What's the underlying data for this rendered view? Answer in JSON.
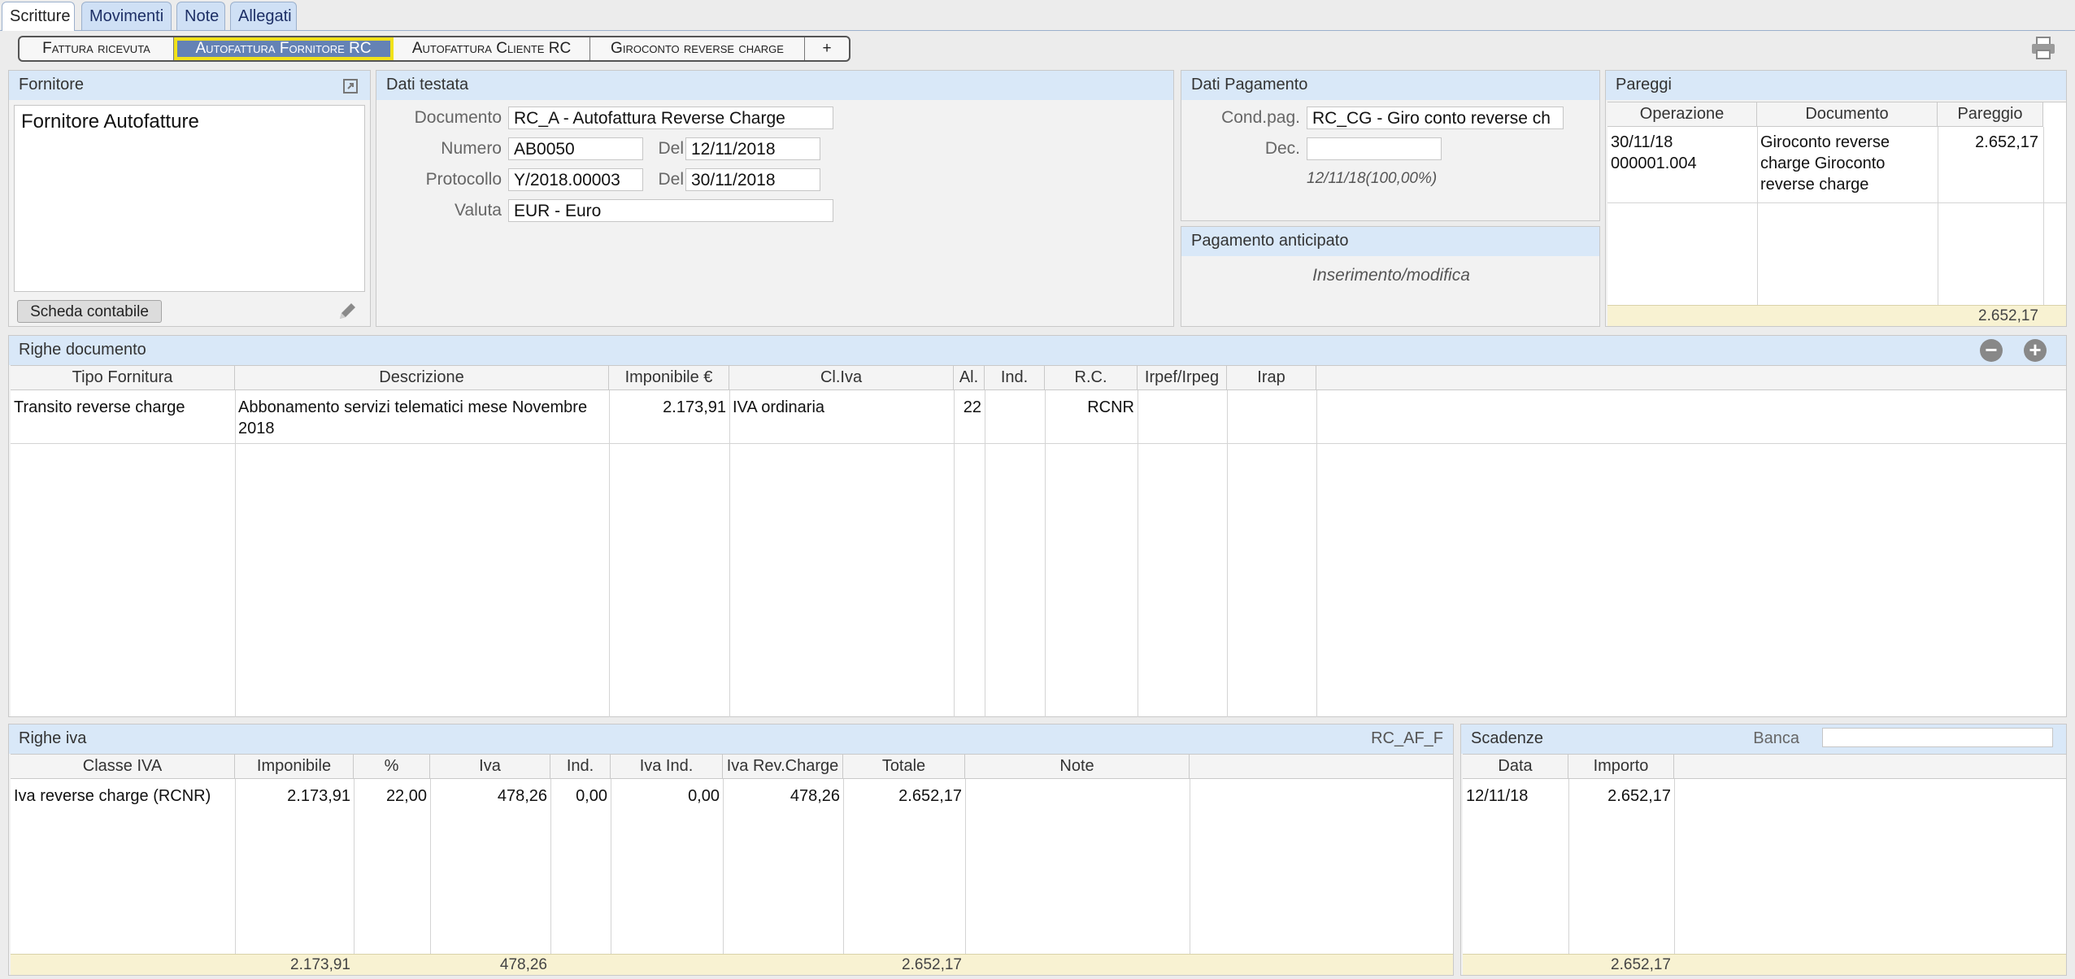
{
  "top_tabs": [
    "Scritture",
    "Movimenti",
    "Note",
    "Allegati"
  ],
  "segments": [
    "Fattura ricevuta",
    "Autofattura Fornitore RC",
    "Autofattura Cliente RC",
    "Giroconto reverse charge",
    "+"
  ],
  "fornitore": {
    "title": "Fornitore",
    "name": "Fornitore Autofatture",
    "button": "Scheda contabile"
  },
  "dati_testata": {
    "title": "Dati testata",
    "documento_label": "Documento",
    "documento": "RC_A - Autofattura Reverse Charge",
    "numero_label": "Numero",
    "numero": "AB0050",
    "del_label": "Del",
    "numero_del": "12/11/2018",
    "protocollo_label": "Protocollo",
    "protocollo": "Y/2018.00003",
    "protocollo_del": "30/11/2018",
    "valuta_label": "Valuta",
    "valuta": "EUR - Euro"
  },
  "dati_pagamento": {
    "title": "Dati Pagamento",
    "cond_label": "Cond.pag.",
    "cond": "RC_CG - Giro conto reverse ch",
    "dec_label": "Dec.",
    "dec": "",
    "info": "12/11/18(100,00%)"
  },
  "pagamento_anticipato": {
    "title": "Pagamento anticipato",
    "text": "Inserimento/modifica"
  },
  "pareggi": {
    "title": "Pareggi",
    "columns": [
      "Operazione",
      "Documento",
      "Pareggio"
    ],
    "rows": [
      {
        "operazione": "30/11/18\n000001.004",
        "documento": "Giroconto reverse\ncharge Giroconto\nreverse charge",
        "pareggio": "2.652,17"
      }
    ],
    "total": "2.652,17"
  },
  "righe_documento": {
    "title": "Righe documento",
    "columns": [
      "Tipo Fornitura",
      "Descrizione",
      "Imponibile €",
      "Cl.Iva",
      "Al.",
      "Ind.",
      "R.C.",
      "Irpef/Irpeg",
      "Irap"
    ],
    "rows": [
      {
        "tipo": "Transito reverse charge",
        "descrizione": "Abbonamento servizi telematici mese Novembre\n2018",
        "imponibile": "2.173,91",
        "cliva": "IVA ordinaria",
        "al": "22",
        "ind": "",
        "rc": "RCNR",
        "irpef": "",
        "irap": ""
      }
    ]
  },
  "righe_iva": {
    "title": "Righe iva",
    "code": "RC_AF_F",
    "columns": [
      "Classe IVA",
      "Imponibile",
      "%",
      "Iva",
      "Ind.",
      "Iva Ind.",
      "Iva Rev.Charge",
      "Totale",
      "Note"
    ],
    "rows": [
      {
        "classe": "Iva reverse charge (RCNR)",
        "imponibile": "2.173,91",
        "perc": "22,00",
        "iva": "478,26",
        "ind": "0,00",
        "iva_ind": "0,00",
        "iva_rev": "478,26",
        "totale": "2.652,17",
        "note": ""
      }
    ],
    "totals": {
      "imponibile": "2.173,91",
      "iva": "478,26",
      "totale": "2.652,17"
    }
  },
  "scadenze": {
    "title": "Scadenze",
    "banca_label": "Banca",
    "banca": "",
    "columns": [
      "Data",
      "Importo"
    ],
    "rows": [
      {
        "data": "12/11/18",
        "importo": "2.652,17"
      }
    ],
    "total": "2.652,17"
  },
  "icons": {
    "print": "printer-icon",
    "edit": "pencil-icon",
    "remove": "minus-circle-icon",
    "add": "plus-circle-icon",
    "expand": "expand-icon"
  },
  "colors": {
    "header_blue": "#d9e8f8",
    "selected_segment": "#6482b5",
    "highlight": "#f1e21a",
    "footer": "#f8f2d2"
  }
}
